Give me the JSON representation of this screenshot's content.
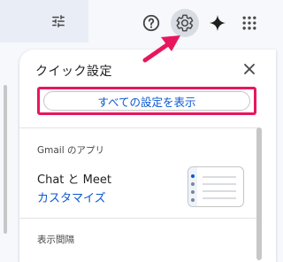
{
  "topbar": {
    "filter_icon": "tune-icon",
    "help_icon": "help-icon",
    "settings_icon": "gear-icon",
    "gemini_icon": "sparkle-icon",
    "apps_icon": "apps-grid-icon"
  },
  "quick_settings": {
    "title": "クイック設定",
    "close_icon": "close-icon",
    "show_all_label": "すべての設定を表示",
    "apps_heading": "Gmail のアプリ",
    "chat_meet_label": "Chat と Meet",
    "customize_label": "カスタマイズ",
    "density_heading": "表示間隔"
  },
  "colors": {
    "accent_blue": "#0b57d0",
    "highlight_pink": "#e8175d"
  }
}
